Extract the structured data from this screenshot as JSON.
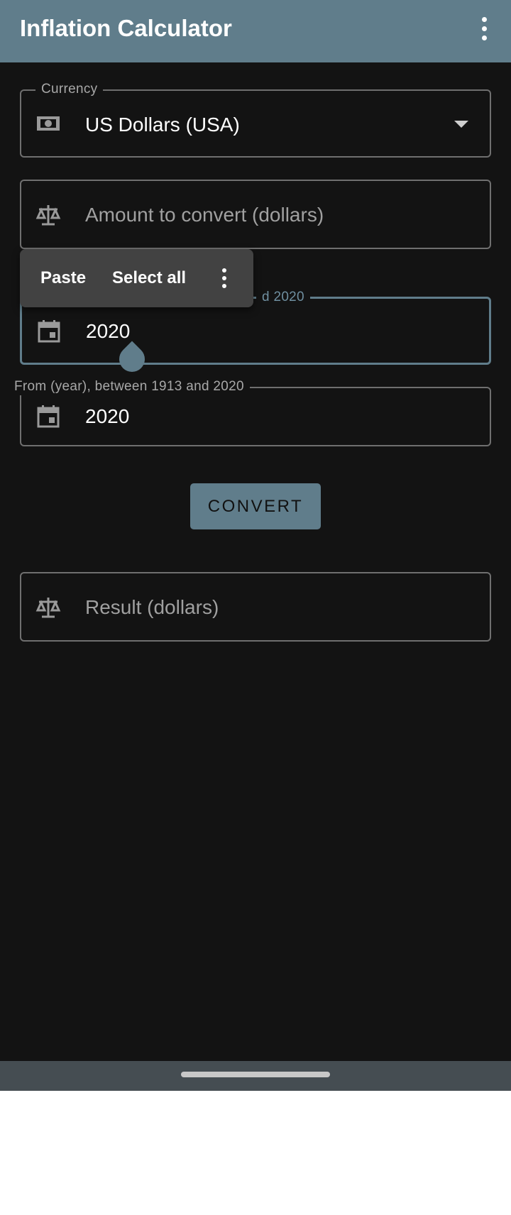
{
  "app": {
    "title": "Inflation Calculator"
  },
  "currency_field": {
    "label": "Currency",
    "value": "US Dollars (USA)",
    "icon": "money-icon"
  },
  "amount_field": {
    "placeholder": "Amount to convert (dollars)",
    "icon": "scale-icon"
  },
  "to_year_field": {
    "label_visible_fragment": "d 2020",
    "value": "2020",
    "icon": "calendar-icon"
  },
  "from_year_field": {
    "label": "From (year), between 1913 and 2020",
    "value": "2020",
    "icon": "calendar-icon"
  },
  "convert_button": {
    "label": "CONVERT"
  },
  "result_field": {
    "placeholder": "Result (dollars)",
    "icon": "scale-icon"
  },
  "context_menu": {
    "items": [
      "Paste",
      "Select all"
    ]
  },
  "colors": {
    "accent": "#607d8b",
    "background": "#131313",
    "menu": "#424242"
  }
}
